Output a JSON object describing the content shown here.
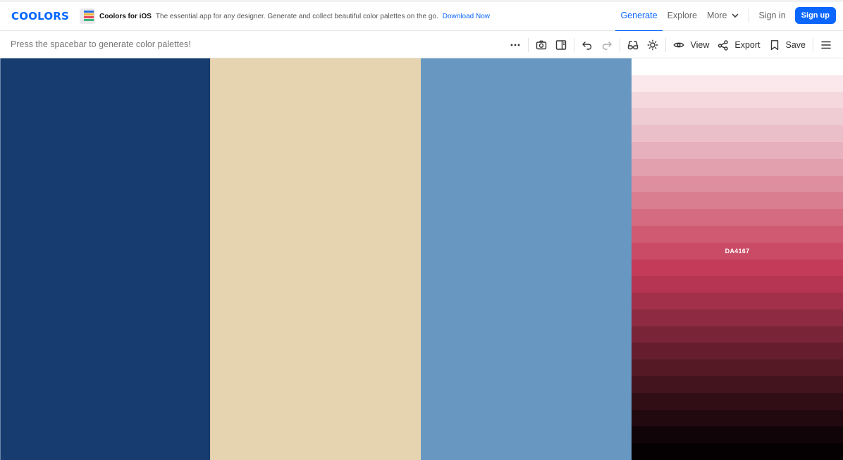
{
  "brand": {
    "logo_text": "COOLORS",
    "color": "#0066ff"
  },
  "promo": {
    "title": "Coolors for iOS",
    "text": "The essential app for any designer. Generate and collect beautiful color palettes on the go.",
    "link": "Download Now"
  },
  "nav": {
    "generate": "Generate",
    "explore": "Explore",
    "more": "More",
    "sign_in": "Sign in",
    "sign_up": "Sign up",
    "accent": "#0a66ff"
  },
  "toolbar": {
    "hint": "Press the spacebar to generate color palettes!",
    "view_label": "View",
    "export_label": "Export",
    "save_label": "Save"
  },
  "palette": {
    "colors": [
      "#173c70",
      "#e6d4b0",
      "#6898c2"
    ],
    "shades": [
      "#ffffff",
      "#fbe8ec",
      "#f4d8de",
      "#efcbd3",
      "#ebbfc9",
      "#e6b0bc",
      "#e29fae",
      "#dd8e9f",
      "#d97d90",
      "#d46b81",
      "#cf5a72",
      "#ca4b66",
      "#c33b59",
      "#b53552",
      "#a2304a",
      "#8e2a41",
      "#7a2438",
      "#661e2f",
      "#551926",
      "#43131e",
      "#310e16",
      "#21090f",
      "#110408",
      "#050102"
    ],
    "selected_shade_index": 11,
    "selected_shade_label": "DA4167"
  }
}
